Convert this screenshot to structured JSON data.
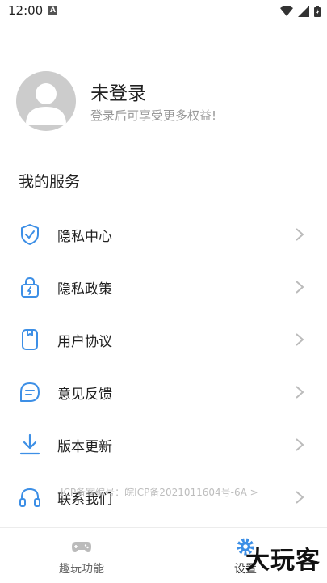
{
  "status_bar": {
    "time": "12:00",
    "a_badge": "A"
  },
  "profile": {
    "name": "未登录",
    "subtitle": "登录后可享受更多权益!"
  },
  "section_title": "我的服务",
  "menu": [
    {
      "label": "隐私中心",
      "icon": "shield-check-icon"
    },
    {
      "label": "隐私政策",
      "icon": "lock-icon"
    },
    {
      "label": "用户协议",
      "icon": "document-icon"
    },
    {
      "label": "意见反馈",
      "icon": "message-icon"
    },
    {
      "label": "版本更新",
      "icon": "download-icon"
    },
    {
      "label": "联系我们",
      "icon": "headphones-icon"
    }
  ],
  "icp_text": "ICP备案编号：皖ICP备2021011604号-6A >",
  "bottom_nav": [
    {
      "label": "趣玩功能",
      "icon": "gamepad-icon"
    },
    {
      "label": "设置",
      "icon": "gear-icon"
    }
  ],
  "watermark": "大玩客",
  "colors": {
    "accent": "#3d8fe6",
    "icon_gray": "#bbbbbb",
    "avatar_gray": "#cccccc"
  }
}
